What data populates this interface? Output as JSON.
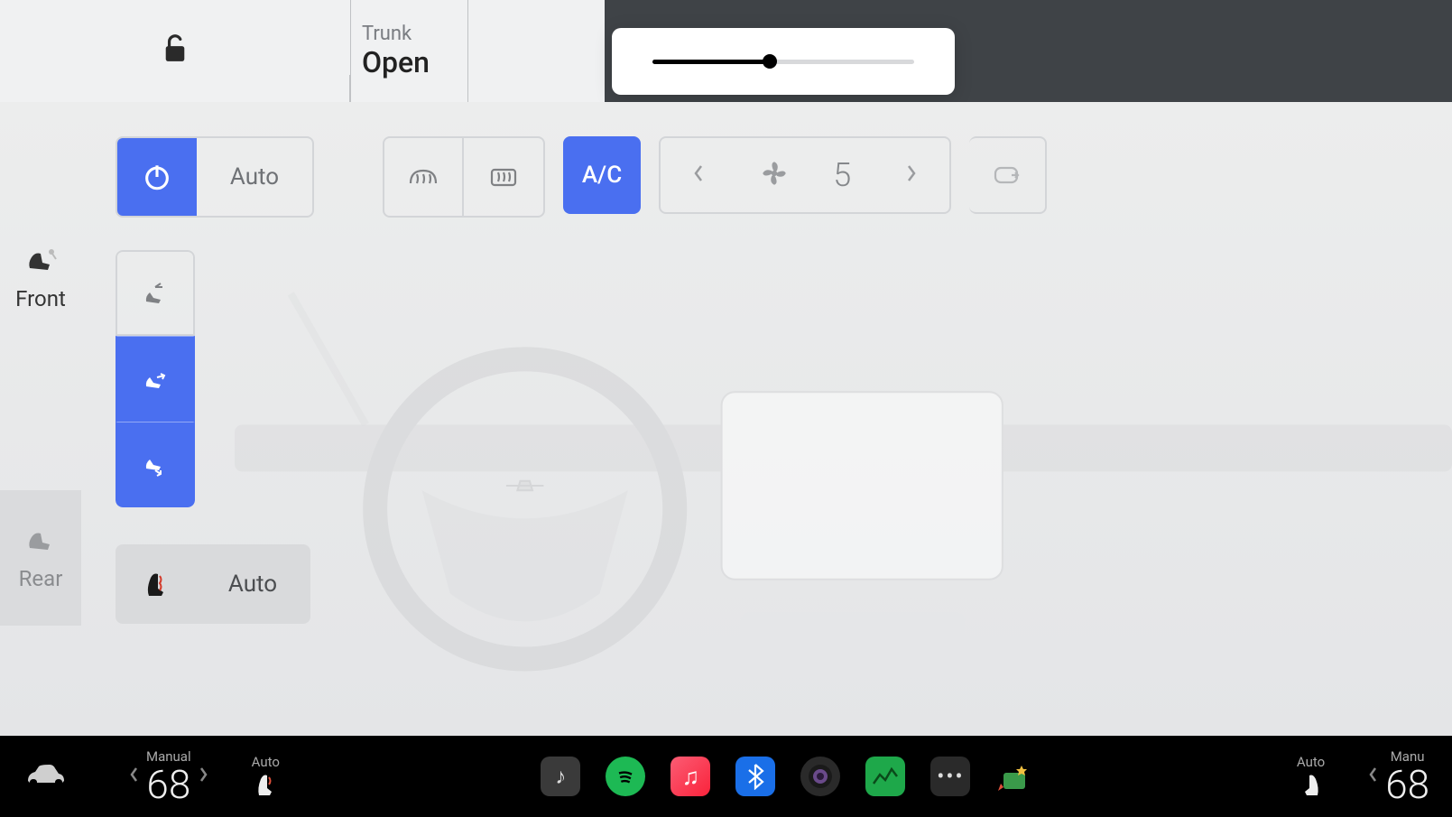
{
  "top": {
    "trunk_label": "Trunk",
    "trunk_status": "Open",
    "slider": {
      "value": 45,
      "max": 100
    }
  },
  "sidebar": {
    "front_label": "Front",
    "rear_label": "Rear"
  },
  "climate": {
    "power_on": true,
    "auto_label": "Auto",
    "ac_label": "A/C",
    "ac_on": true,
    "fan_speed": "5",
    "airflow": {
      "face": false,
      "body": true,
      "feet": true
    },
    "seat_auto_label": "Auto"
  },
  "dock": {
    "left_temp": {
      "mode": "Manual",
      "value": "68"
    },
    "left_seat": {
      "mode": "Auto"
    },
    "right_seat": {
      "mode": "Auto"
    },
    "right_temp": {
      "mode": "Manu",
      "value": "68"
    },
    "apps": [
      "music",
      "spotify",
      "apple-music",
      "bluetooth",
      "camera",
      "energy",
      "all-apps",
      "toybox"
    ]
  },
  "colors": {
    "accent": "#4a6ff0"
  }
}
